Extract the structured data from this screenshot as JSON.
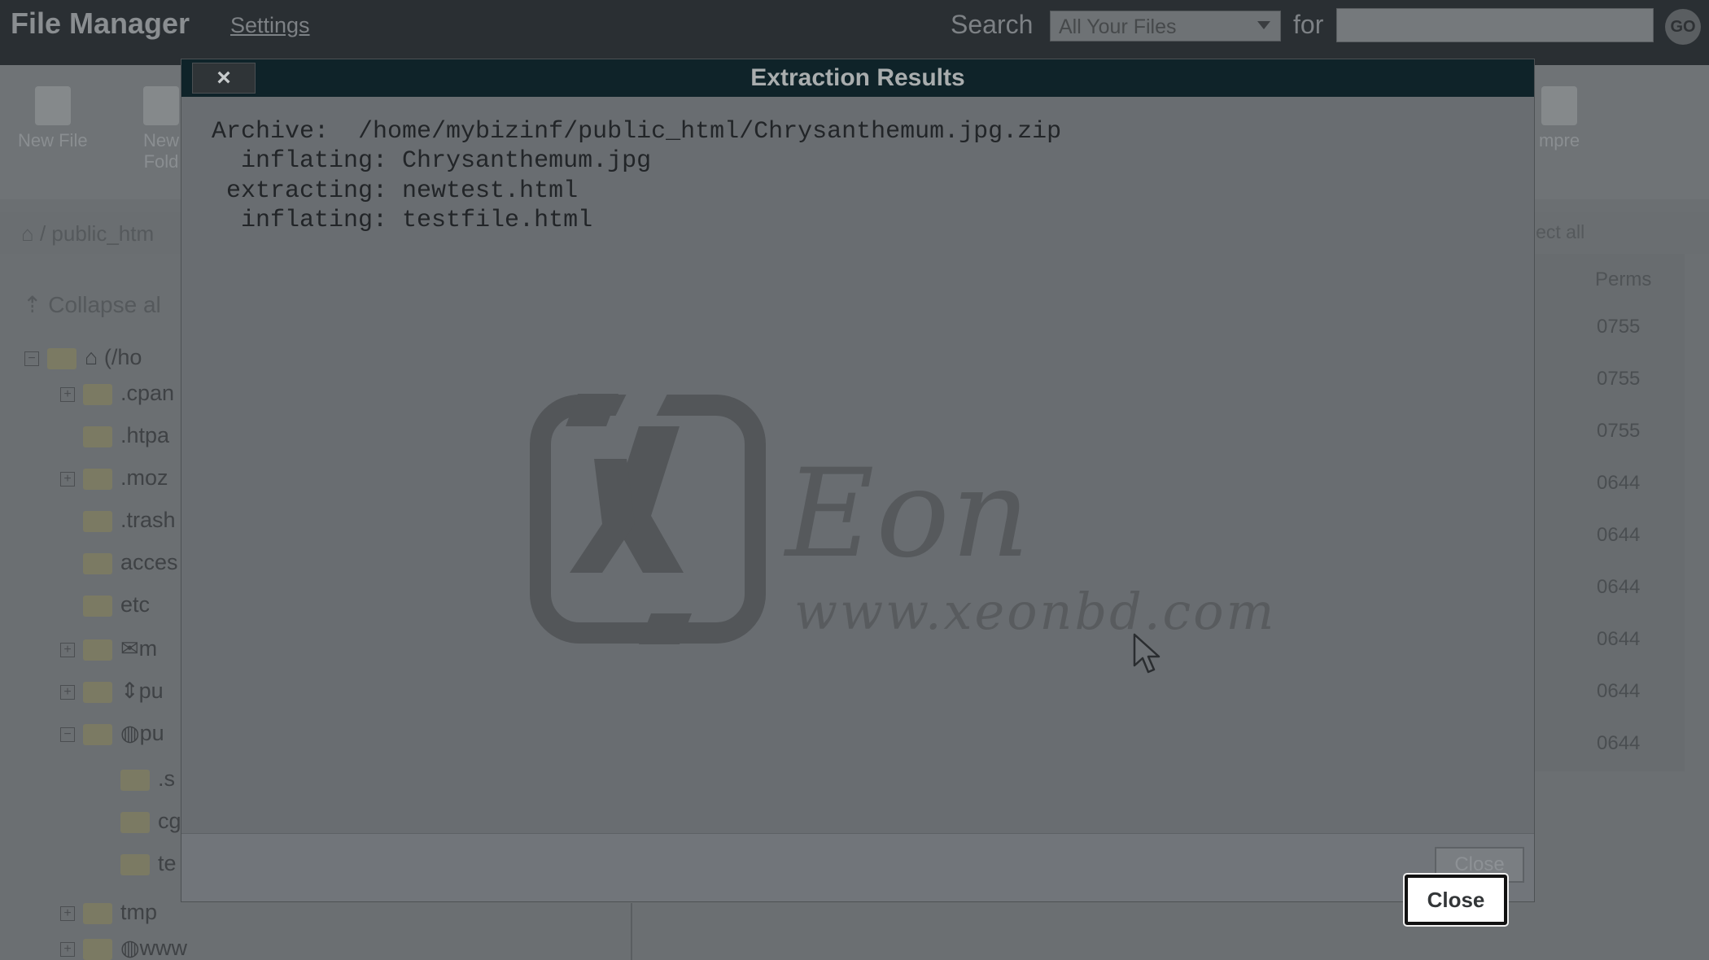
{
  "app": {
    "title": "File Manager",
    "settings_link": "Settings",
    "search_label": "Search",
    "search_scope": "All Your Files",
    "for_label": "for",
    "search_value": "",
    "go_label": "GO"
  },
  "toolbar": {
    "new_file": "New File",
    "new_folder_partial": "New Fold",
    "compress_partial": "mpre"
  },
  "breadcrumb": "/ public_htm",
  "select_all_partial": "lect all",
  "collapse_label": "Collapse al",
  "tree": {
    "root": "(/ho",
    "items": [
      ".cpan",
      ".htpa",
      ".moz",
      ".trash",
      "acces",
      "etc",
      "m",
      "pu",
      "pu",
      ".s",
      "cg",
      "te",
      "tmp",
      "www"
    ]
  },
  "perms": {
    "header": "Perms",
    "values": [
      "0755",
      "0755",
      "0755",
      "0644",
      "0644",
      "0644",
      "0644",
      "0644",
      "0644"
    ]
  },
  "modal": {
    "close_x": "×",
    "title": "Extraction Results",
    "log": [
      "Archive:  /home/mybizinf/public_html/Chrysanthemum.jpg.zip",
      "  inflating: Chrysanthemum.jpg",
      " extracting: newtest.html",
      "  inflating: testfile.html"
    ],
    "ghost_close": "Close",
    "close_button": "Close"
  },
  "watermark": {
    "brand": "Eon",
    "url": "www.xeonbd.com"
  },
  "colors": {
    "overlay": "#6a6e72",
    "header": "#0f2329",
    "close_border": "#111111"
  }
}
